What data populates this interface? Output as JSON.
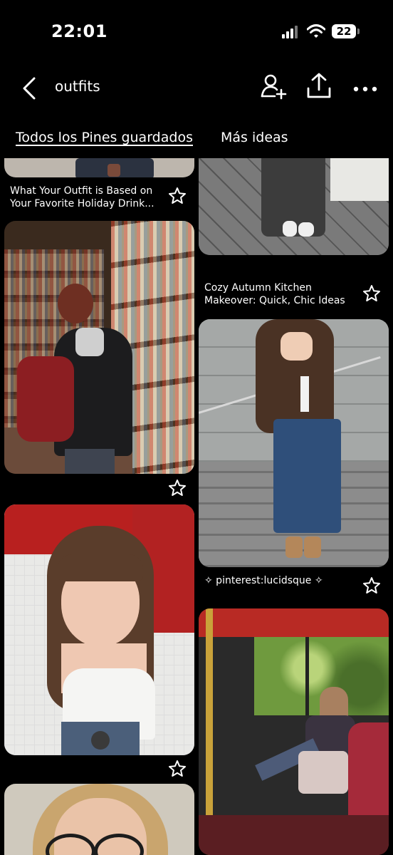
{
  "status_bar": {
    "time": "22:01",
    "battery": "22"
  },
  "header": {
    "title": "outfits"
  },
  "tabs": [
    {
      "label": "Todos los Pines guardados"
    },
    {
      "label": "Más ideas"
    }
  ],
  "pins": {
    "left": [
      {
        "caption": "What Your Outfit is Based on Your Favorite Holiday Drink..."
      },
      {
        "caption": ""
      },
      {
        "caption": ""
      }
    ],
    "right": [
      {
        "caption": "Cozy Autumn Kitchen Makeover: Quick, Chic Ideas"
      },
      {
        "caption": "✧ pinterest:lucidsque ✧"
      }
    ]
  },
  "colors": {
    "background": "#000000",
    "text": "#ffffff"
  }
}
